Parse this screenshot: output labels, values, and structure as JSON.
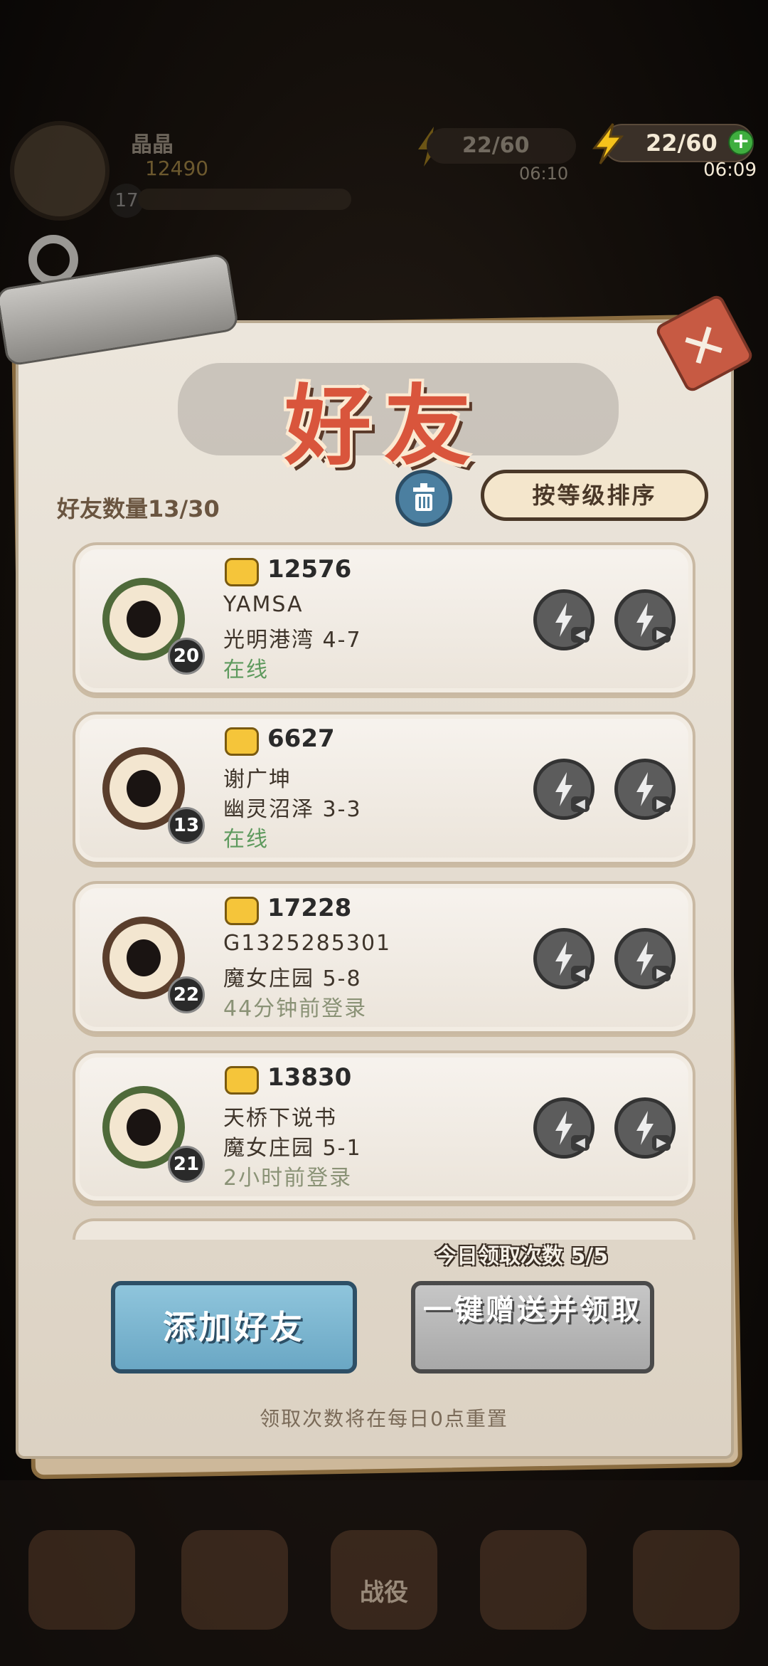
{
  "player": {
    "name": "晶晶",
    "power": "12490",
    "level": "17"
  },
  "energy_bg": {
    "value": "22/60",
    "timer": "06:10"
  },
  "energy": {
    "value": "22/60",
    "timer": "06:09"
  },
  "panel": {
    "title": "好友",
    "friend_count": "好友数量13/30",
    "sort_label": "按等级排序",
    "friends": [
      {
        "power": "12576",
        "name": "YAMSA",
        "stage": "光明港湾 4-7",
        "status": "在线",
        "level": "20"
      },
      {
        "power": "6627",
        "name": "谢广坤",
        "stage": "幽灵沼泽 3-3",
        "status": "在线",
        "level": "13"
      },
      {
        "power": "17228",
        "name": "G1325285301",
        "stage": "魔女庄园 5-8",
        "status": "44分钟前登录",
        "level": "22"
      },
      {
        "power": "13830",
        "name": "天桥下说书",
        "stage": "魔女庄园 5-1",
        "status": "2小时前登录",
        "level": "21"
      }
    ],
    "daily_claims": "今日领取次数 5/5",
    "add_friend_label": "添加好友",
    "send_all_label": "一键赠送并领取",
    "reset_note": "领取次数将在每日0点重置"
  },
  "bottom_nav": {
    "center_label": "战役"
  },
  "colors": {
    "title": "#d9553c",
    "add_button": "#6aa7c4",
    "send_button": "#a8a8a8",
    "online": "#5e9a5e"
  }
}
